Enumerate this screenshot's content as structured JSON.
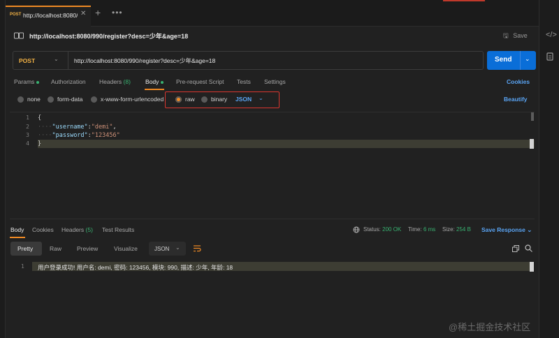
{
  "tab": {
    "method": "POST",
    "title": "http://localhost:8080/"
  },
  "request": {
    "title": "http://localhost:8080/990/register?desc=少年&age=18",
    "save_label": "Save",
    "method": "POST",
    "url": "http://localhost:8080/990/register?desc=少年&age=18",
    "send_label": "Send"
  },
  "request_tabs": {
    "params": "Params",
    "authorization": "Authorization",
    "headers": "Headers",
    "headers_count": "(8)",
    "body": "Body",
    "prerequest": "Pre-request Script",
    "tests": "Tests",
    "settings": "Settings",
    "cookies": "Cookies"
  },
  "body_types": {
    "none": "none",
    "form_data": "form-data",
    "urlencoded": "x-www-form-urlencoded",
    "raw": "raw",
    "binary": "binary",
    "format": "JSON",
    "beautify": "Beautify"
  },
  "editor": {
    "line_numbers": [
      "1",
      "2",
      "3",
      "4"
    ],
    "line1": "{",
    "line2_key": "\"username\"",
    "line2_val": "\"demi\"",
    "line3_key": "\"password\"",
    "line3_val": "\"123456\"",
    "line4": "}"
  },
  "response": {
    "tabs": {
      "body": "Body",
      "cookies": "Cookies",
      "headers": "Headers",
      "headers_count": "(5)",
      "test_results": "Test Results"
    },
    "status_label": "Status:",
    "status_value": "200 OK",
    "time_label": "Time:",
    "time_value": "6 ms",
    "size_label": "Size:",
    "size_value": "254 B",
    "save_response": "Save Response",
    "formats": {
      "pretty": "Pretty",
      "raw": "Raw",
      "preview": "Preview",
      "visualize": "Visualize",
      "json": "JSON"
    },
    "line_number": "1",
    "content": "用户登录成功! 用户名: demi, 密码: 123456, 模块: 990, 描述: 少年, 年龄: 18"
  },
  "watermark": "@稀土掘金技术社区",
  "colors": {
    "accent_orange": "#f08a24",
    "send_blue": "#0a6ed8",
    "link_blue": "#5aa5f5",
    "status_green": "#38b271",
    "highlight_box": "#d9362f"
  }
}
